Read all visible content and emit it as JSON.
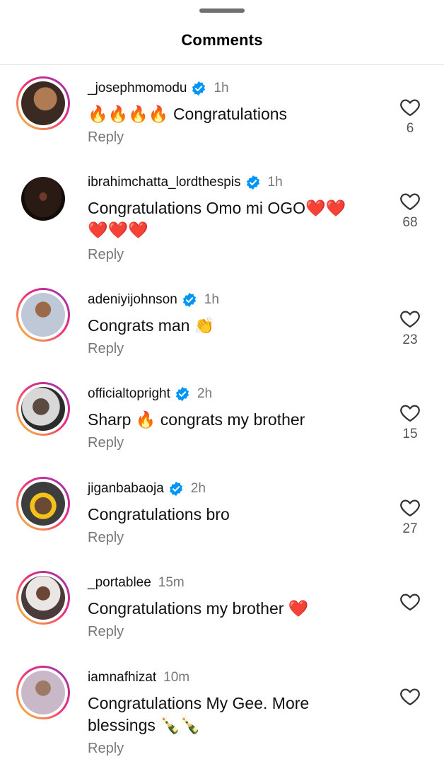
{
  "header": {
    "title": "Comments"
  },
  "comments": [
    {
      "username": "_josephmomodu",
      "verified": true,
      "time": "1h",
      "text": "🔥🔥🔥🔥 Congratulations",
      "reply": "Reply",
      "likes": "6"
    },
    {
      "username": "ibrahimchatta_lordthespis",
      "verified": true,
      "time": "1h",
      "text": "Congratulations Omo mi OGO❤️❤️❤️❤️❤️",
      "reply": "Reply",
      "likes": "68"
    },
    {
      "username": "adeniyijohnson",
      "verified": true,
      "time": "1h",
      "text": "Congrats man 👏",
      "reply": "Reply",
      "likes": "23"
    },
    {
      "username": "officialtopright",
      "verified": true,
      "time": "2h",
      "text": "Sharp 🔥 congrats my brother",
      "reply": "Reply",
      "likes": "15"
    },
    {
      "username": "jiganbabaoja",
      "verified": true,
      "time": "2h",
      "text": "Congratulations bro",
      "reply": "Reply",
      "likes": "27"
    },
    {
      "username": "_portablee",
      "verified": false,
      "time": "15m",
      "text": "Congratulations my brother ❤️",
      "reply": "Reply",
      "likes": ""
    },
    {
      "username": "iamnafhizat",
      "verified": false,
      "time": "10m",
      "text": "Congratulations My Gee. More blessings 🍾🍾",
      "reply": "Reply",
      "likes": ""
    }
  ],
  "colors": {
    "verified_blue": "#0095f6",
    "muted_text": "#777777",
    "ring_start": "#f9ce34",
    "ring_end": "#8a3ab9"
  },
  "icons": {
    "like": "heart-outline-icon",
    "verified": "verified-badge-icon"
  }
}
